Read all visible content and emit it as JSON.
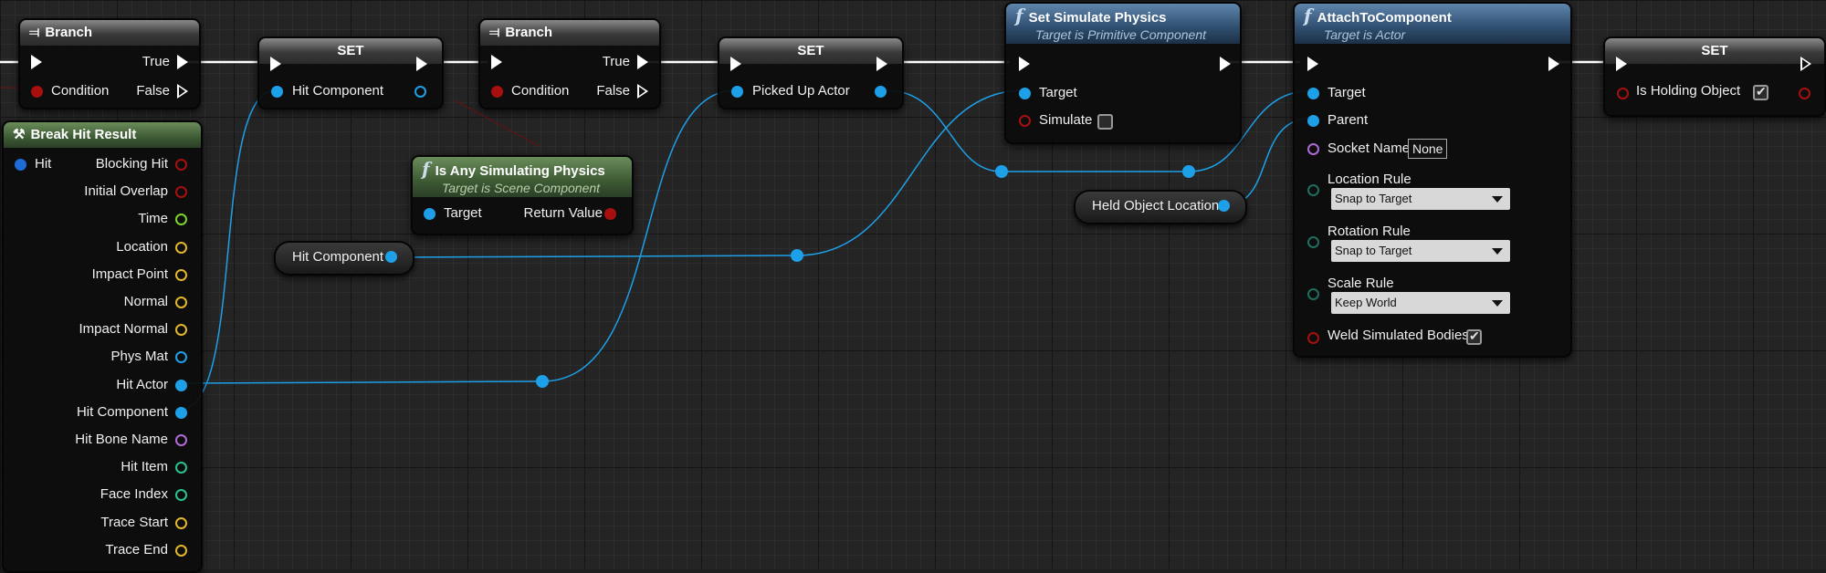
{
  "colors": {
    "object_pin": "#1ea0e8",
    "bool_pin": "#a80f0f",
    "float_pin": "#7dd32a",
    "vector_pin": "#e2b82a",
    "name_pin": "#b06ad8",
    "int_pin": "#27c48f",
    "enum_pin": "#1e6f5e",
    "exec": "#ffffff"
  },
  "nodes": {
    "branch1": {
      "title": "Branch",
      "true_label": "True",
      "false_label": "False",
      "condition_label": "Condition"
    },
    "set1": {
      "title": "SET",
      "input_label": "Hit Component"
    },
    "branch2": {
      "title": "Branch",
      "true_label": "True",
      "false_label": "False",
      "condition_label": "Condition"
    },
    "set2": {
      "title": "SET",
      "input_label": "Picked Up Actor"
    },
    "set_sim": {
      "title": "Set Simulate Physics",
      "subtitle": "Target is Primitive Component",
      "target_label": "Target",
      "simulate_label": "Simulate",
      "simulate_checked": false
    },
    "attach": {
      "title": "AttachToComponent",
      "subtitle": "Target is Actor",
      "target_label": "Target",
      "parent_label": "Parent",
      "socket_label": "Socket Name",
      "socket_value": "None",
      "location_rule_label": "Location Rule",
      "location_rule_value": "Snap to Target",
      "rotation_rule_label": "Rotation Rule",
      "rotation_rule_value": "Snap to Target",
      "scale_rule_label": "Scale Rule",
      "scale_rule_value": "Keep World",
      "weld_label": "Weld Simulated Bodies",
      "weld_checked": true
    },
    "set3": {
      "title": "SET",
      "input_label": "Is Holding Object",
      "checked": true
    },
    "is_sim": {
      "title": "Is Any Simulating Physics",
      "subtitle": "Target is Scene Component",
      "target_label": "Target",
      "return_label": "Return Value"
    },
    "break_hit": {
      "title": "Break Hit Result",
      "input_label": "Hit",
      "outputs": [
        "Blocking Hit",
        "Initial Overlap",
        "Time",
        "Location",
        "Impact Point",
        "Normal",
        "Impact Normal",
        "Phys Mat",
        "Hit Actor",
        "Hit Component",
        "Hit Bone Name",
        "Hit Item",
        "Face Index",
        "Trace Start",
        "Trace End"
      ]
    },
    "hit_component_var": {
      "label": "Hit Component"
    },
    "held_object_var": {
      "label": "Held Object Location"
    }
  }
}
